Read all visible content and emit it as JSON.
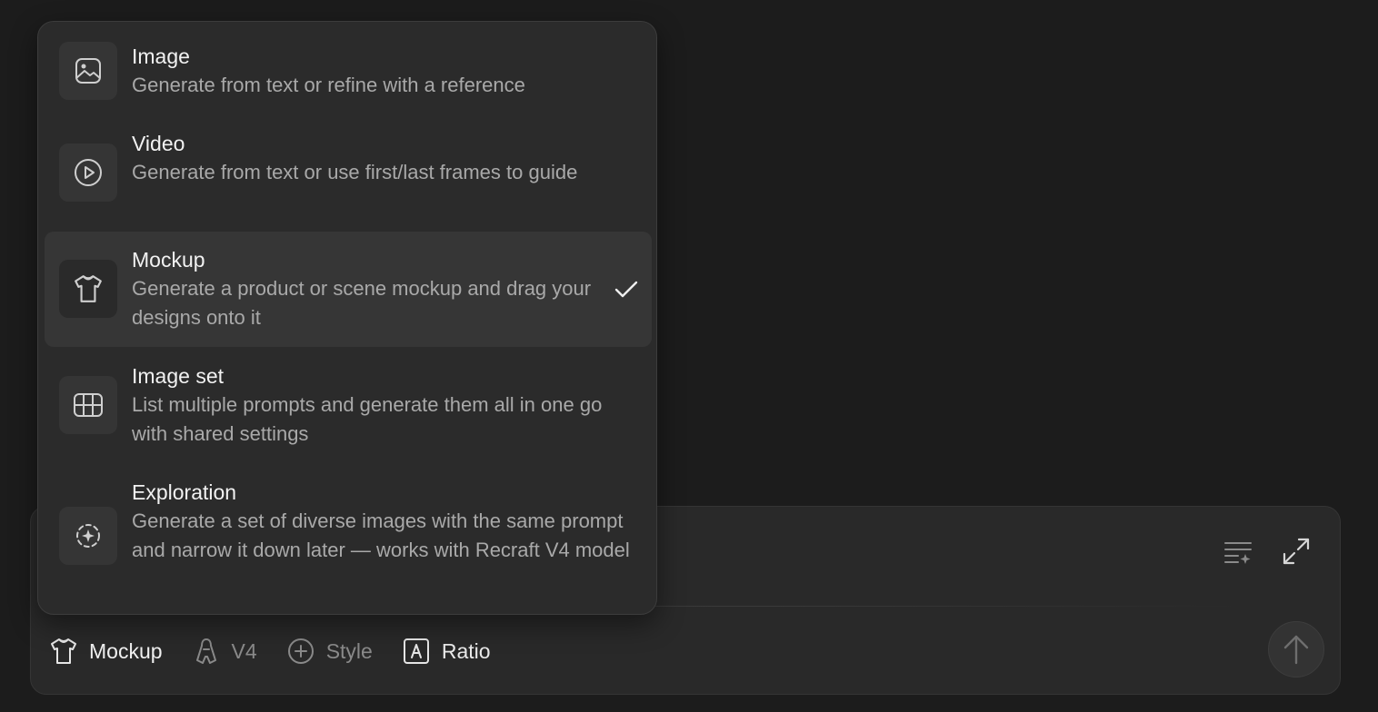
{
  "menu": {
    "items": [
      {
        "id": "image",
        "title": "Image",
        "description": "Generate from text or refine with a reference",
        "selected": false,
        "icon": "image-icon"
      },
      {
        "id": "video",
        "title": "Video",
        "description": "Generate from text or use first/last frames to guide",
        "selected": false,
        "icon": "play-circle-icon"
      },
      {
        "id": "mockup",
        "title": "Mockup",
        "description": "Generate a product or scene mockup and drag your designs onto it",
        "selected": true,
        "icon": "tshirt-icon"
      },
      {
        "id": "image-set",
        "title": "Image set",
        "description": "List multiple prompts and generate them all in one go with shared settings",
        "selected": false,
        "icon": "grid-icon"
      },
      {
        "id": "exploration",
        "title": "Exploration",
        "description": "Generate a set of diverse images with the same prompt and narrow it down later — works with Recraft V4 model",
        "selected": false,
        "icon": "sparkle-focus-icon"
      }
    ]
  },
  "toolbar": {
    "mode_label": "Mockup",
    "model_label": "V4",
    "style_label": "Style",
    "ratio_label": "Ratio"
  },
  "colors": {
    "background": "#1c1c1c",
    "panel": "#292929",
    "menu": "#2b2b2b",
    "selected_item": "#363636",
    "muted_text": "#8a8a8a"
  }
}
